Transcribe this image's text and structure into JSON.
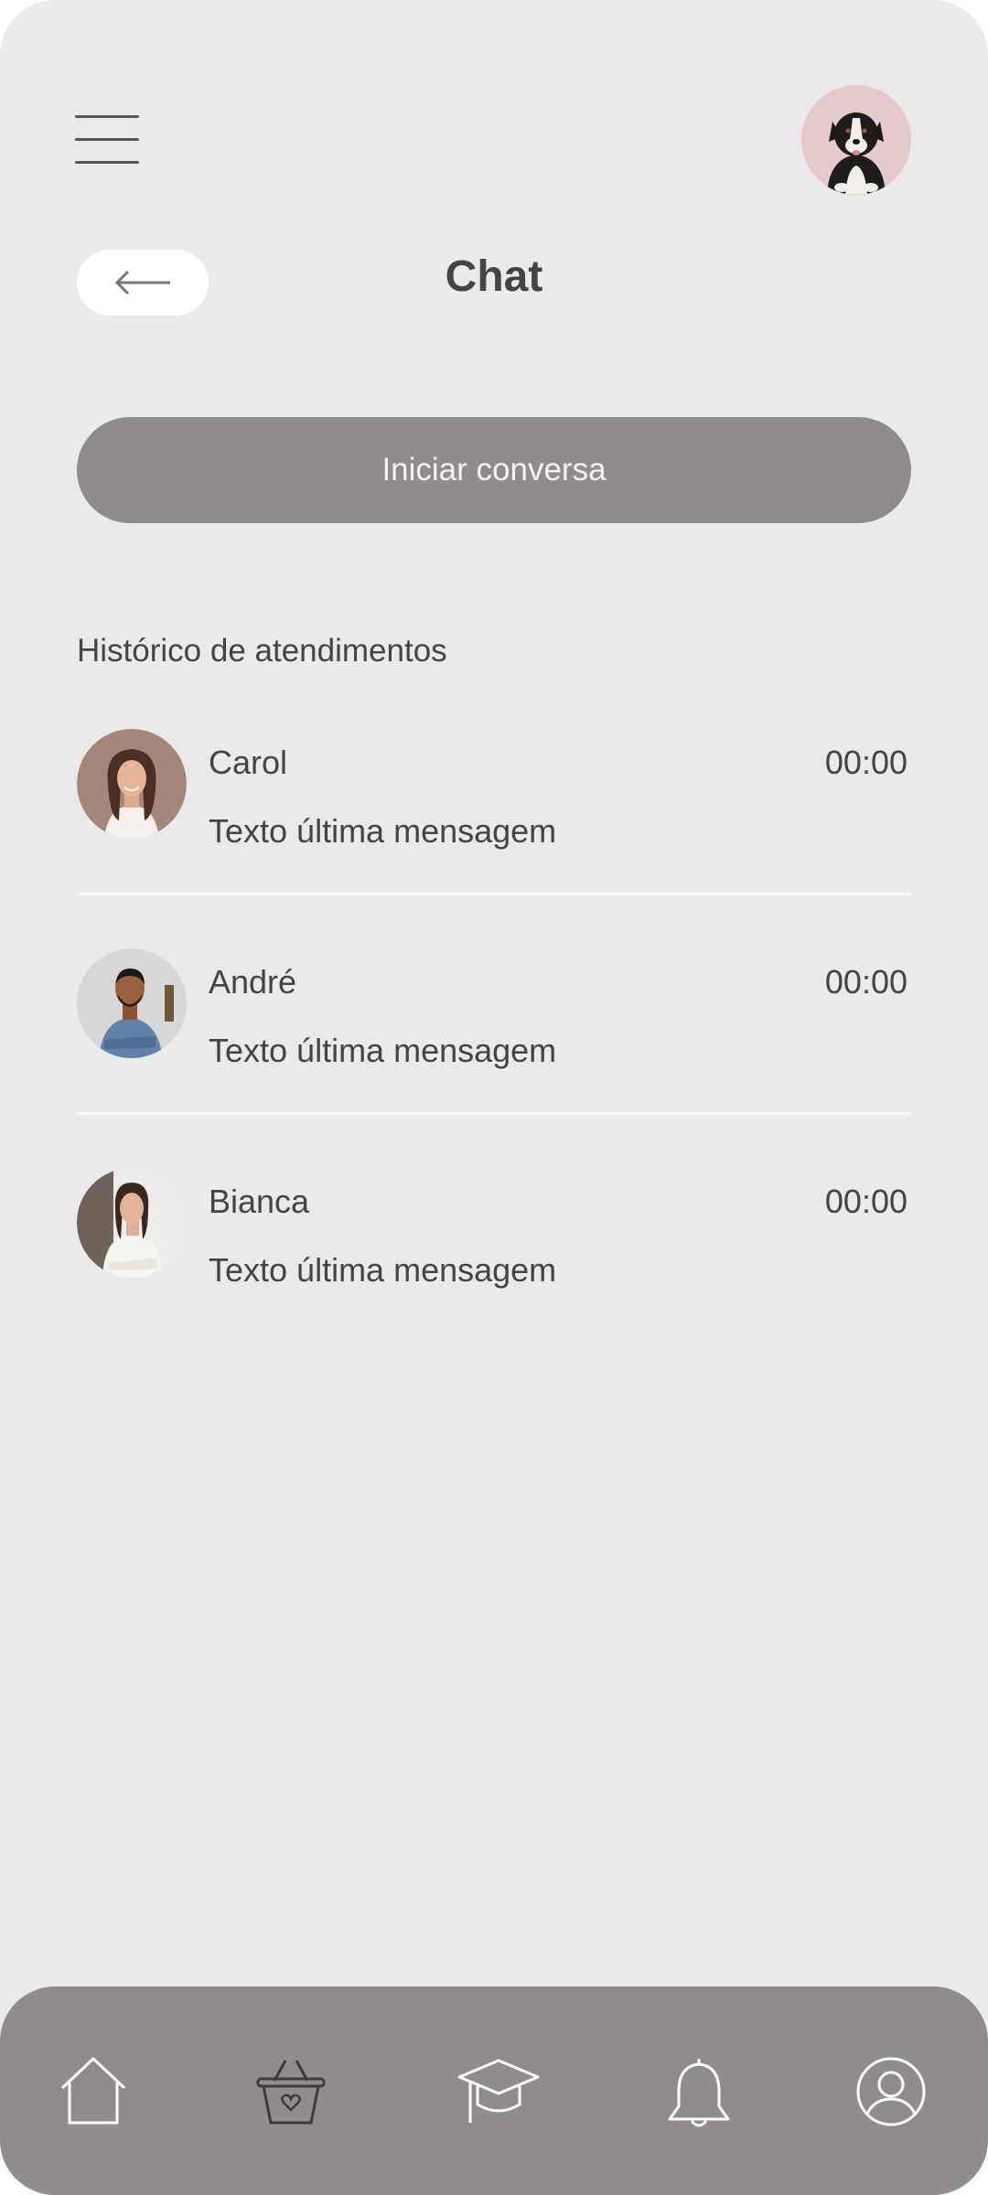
{
  "header": {
    "menu_icon": "hamburger-menu-icon",
    "profile_avatar": "dog-avatar",
    "back_icon": "arrow-left-icon",
    "title": "Chat"
  },
  "actions": {
    "start_conversation_label": "Iniciar conversa"
  },
  "history": {
    "title": "Histórico de atendimentos",
    "items": [
      {
        "name": "Carol",
        "time": "00:00",
        "last_message": "Texto última mensagem"
      },
      {
        "name": "André",
        "time": "00:00",
        "last_message": "Texto última mensagem"
      },
      {
        "name": "Bianca",
        "time": "00:00",
        "last_message": "Texto última mensagem"
      }
    ]
  },
  "bottom_nav": {
    "items": [
      "home-icon",
      "basket-icon",
      "graduation-cap-icon",
      "bell-icon",
      "user-icon"
    ]
  },
  "colors": {
    "background": "#ebeaea",
    "accent": "#918c8c",
    "text": "#444444",
    "profile_bg": "#e6c9cb"
  }
}
